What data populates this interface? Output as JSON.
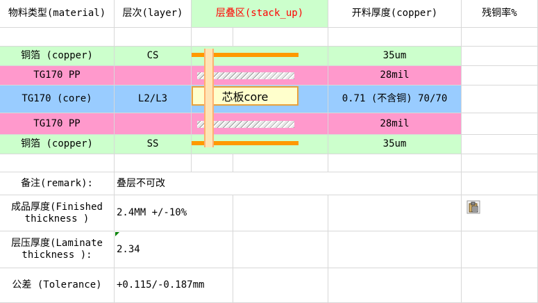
{
  "header": {
    "material": "物料类型(material)",
    "layer": "层次(layer)",
    "stack_up": "层叠区(stack_up)",
    "copper": "开料厚度(copper)",
    "residual": "残铜率%"
  },
  "rows": [
    {
      "material": "铜箔 (copper)",
      "layer": "CS",
      "thickness": "35um"
    },
    {
      "material": "TG170  PP",
      "layer": "",
      "thickness": "28mil"
    },
    {
      "material": "TG170 (core)",
      "layer": "L2/L3",
      "thickness": "0.71 (不含铜)  70/70",
      "core_label": "芯板core"
    },
    {
      "material": "TG170  PP",
      "layer": "",
      "thickness": "28mil"
    },
    {
      "material": "铜箔 (copper)",
      "layer": "SS",
      "thickness": "35um"
    }
  ],
  "remark": {
    "label": "备注(remark):",
    "value": "叠层不可改"
  },
  "finished": {
    "label": "成品厚度(Finished thickness )",
    "value": "2.4MM +/-10%"
  },
  "laminate": {
    "label": "层压厚度(Laminate thickness ):",
    "value": "2.34"
  },
  "tolerance": {
    "label": "公差 (Tolerance)",
    "value": "+0.115/-0.187mm"
  },
  "icons": {
    "paste": "paste-clipboard-icon"
  },
  "colors": {
    "copper_row": "#ccffcc",
    "pp_row": "#ff99cc",
    "core_row": "#99ccff",
    "copper_trace": "#ff9900"
  }
}
